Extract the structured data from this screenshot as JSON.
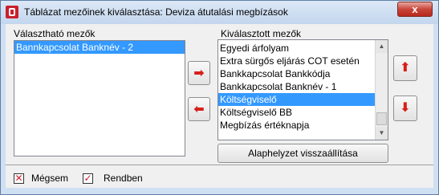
{
  "window": {
    "title": "Táblázat mezőinek kiválasztása: Deviza átutalási megbízások",
    "close_glyph": "x"
  },
  "available": {
    "label": "Választható mezők",
    "items": [
      {
        "text": "Bannkapcsolat Banknév - 2",
        "selected": true
      }
    ]
  },
  "selected_fields": {
    "label": "Kiválasztott mezők",
    "items": [
      {
        "text": "Egyedi árfolyam",
        "selected": false
      },
      {
        "text": "Extra sürgős eljárás COT esetén",
        "selected": false
      },
      {
        "text": "Bankkapcsolat Bankkódja",
        "selected": false
      },
      {
        "text": "Bankkapcsolat Banknév - 1",
        "selected": false
      },
      {
        "text": "Költségviselő",
        "selected": true
      },
      {
        "text": "Költségviselő BB",
        "selected": false
      },
      {
        "text": "Megbízás értéknapja",
        "selected": false
      }
    ]
  },
  "buttons": {
    "move_right": "➡",
    "move_left": "⬅",
    "move_up": "⬆",
    "move_down": "⬇",
    "reset": "Alaphelyzet visszaállítása"
  },
  "footer": {
    "cancel_label": "Mégsem",
    "ok_label": "Rendben"
  },
  "colors": {
    "selection": "#3399ff",
    "arrow": "#d6201b"
  }
}
